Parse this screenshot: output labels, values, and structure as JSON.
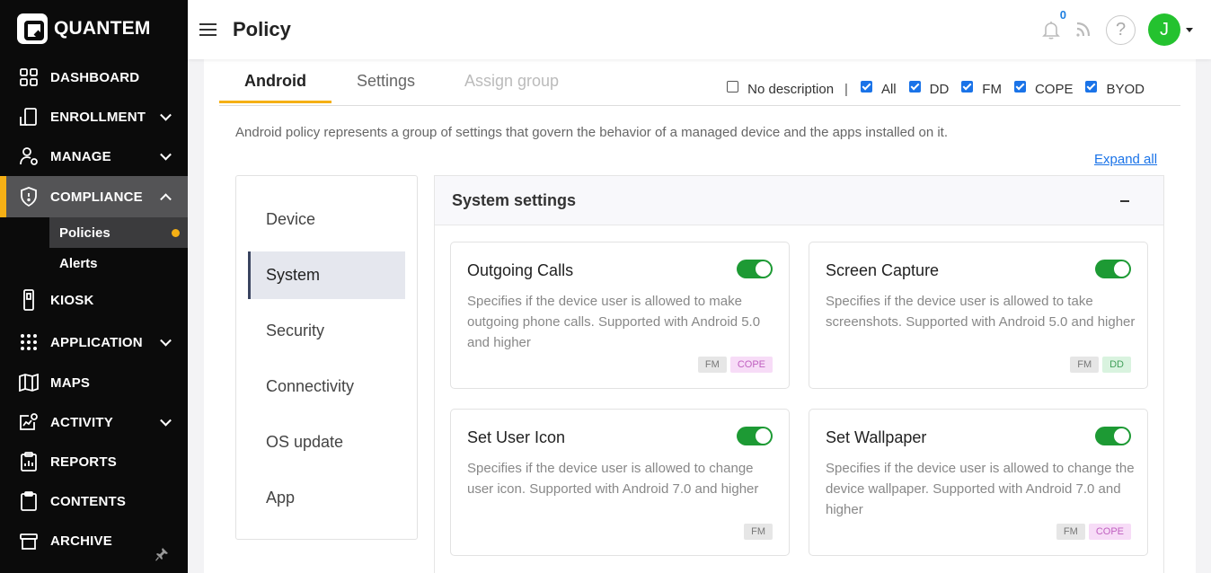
{
  "brand": {
    "name": "QUANTEM"
  },
  "sidebar": {
    "items": [
      {
        "label": "DASHBOARD",
        "icon": "dashboard-icon"
      },
      {
        "label": "ENROLLMENT",
        "icon": "enrollment-icon"
      },
      {
        "label": "MANAGE",
        "icon": "manage-icon"
      },
      {
        "label": "COMPLIANCE",
        "icon": "shield-icon"
      },
      {
        "label": "KIOSK",
        "icon": "kiosk-icon"
      },
      {
        "label": "APPLICATION",
        "icon": "apps-grid-icon"
      },
      {
        "label": "MAPS",
        "icon": "map-icon"
      },
      {
        "label": "ACTIVITY",
        "icon": "activity-icon"
      },
      {
        "label": "REPORTS",
        "icon": "reports-icon"
      },
      {
        "label": "CONTENTS",
        "icon": "clipboard-icon"
      },
      {
        "label": "ARCHIVE",
        "icon": "archive-icon"
      }
    ],
    "compliance_sub": [
      {
        "label": "Policies"
      },
      {
        "label": "Alerts"
      }
    ]
  },
  "header": {
    "title": "Policy",
    "notification_count": "0",
    "help_label": "?",
    "avatar_initial": "J"
  },
  "tabs": [
    {
      "label": "Android"
    },
    {
      "label": "Settings"
    },
    {
      "label": "Assign group"
    }
  ],
  "filters": {
    "no_description": "No description",
    "separator": "|",
    "options": [
      {
        "label": "All",
        "checked": true
      },
      {
        "label": "DD",
        "checked": true
      },
      {
        "label": "FM",
        "checked": true
      },
      {
        "label": "COPE",
        "checked": true
      },
      {
        "label": "BYOD",
        "checked": true
      }
    ]
  },
  "description": "Android policy represents a group of settings that govern the behavior of a managed device and the apps installed on it.",
  "expand_all": "Expand all",
  "categories": [
    "Device",
    "System",
    "Security",
    "Connectivity",
    "OS update",
    "App"
  ],
  "section": {
    "title": "System settings",
    "cards": [
      {
        "title": "Outgoing Calls",
        "desc": "Specifies if the device user is allowed to make outgoing phone calls. Supported with Android 5.0 and higher",
        "tags": [
          "FM",
          "COPE"
        ]
      },
      {
        "title": "Screen Capture",
        "desc": "Specifies if the device user is allowed to take screenshots. Supported with Android 5.0 and higher",
        "tags": [
          "FM",
          "DD"
        ]
      },
      {
        "title": "Set User Icon",
        "desc": "Specifies if the device user is allowed to change user icon. Supported with Android 7.0 and higher",
        "tags": [
          "FM"
        ]
      },
      {
        "title": "Set Wallpaper",
        "desc": "Specifies if the device user is allowed to change the device wallpaper. Supported with Android 7.0 and higher",
        "tags": [
          "FM",
          "COPE"
        ]
      }
    ]
  },
  "colors": {
    "accent": "#f5b015",
    "toggle_on": "#1d9a34",
    "link": "#1a73e8",
    "avatar": "#24c22f"
  }
}
